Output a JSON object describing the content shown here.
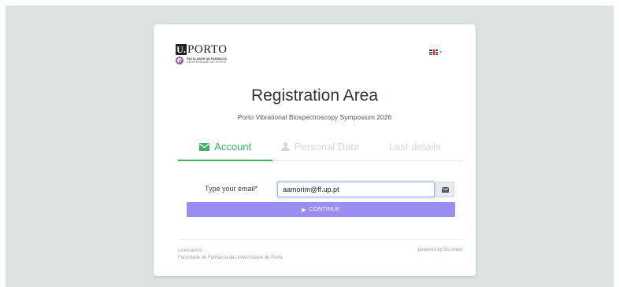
{
  "logo": {
    "u_letter": "U.",
    "word": "PORTO",
    "faculty_line1": "FACULDADE DE FARMÁCIA",
    "faculty_line2": "UNIVERSIDADE DO PORTO"
  },
  "language": {
    "flag_icon": "uk-flag-icon",
    "caret": "▾"
  },
  "title": "Registration Area",
  "subtitle": "Porto Vibrational Biospectroscopy Symposium 2026",
  "tabs": [
    {
      "label": "Account",
      "icon": "envelope-icon",
      "active": true
    },
    {
      "label": "Personal Data",
      "icon": "user-icon",
      "active": false
    },
    {
      "label": "Last details",
      "icon": "",
      "active": false
    }
  ],
  "form": {
    "email_label": "Type your email*",
    "email_value": "aamorim@ff.up.pt",
    "addon_icon": "envelope-icon"
  },
  "continue_label": "CONTINUE",
  "footer": {
    "licensed_to": "Licensed to",
    "licensee": "Faculdade de Farmácia da Universidade do Porto",
    "powered_by": "powered by Sci-meet"
  },
  "colors": {
    "accent_green": "#3db55a",
    "button_purple": "#9b8ef2",
    "background": "#dde3e3"
  }
}
